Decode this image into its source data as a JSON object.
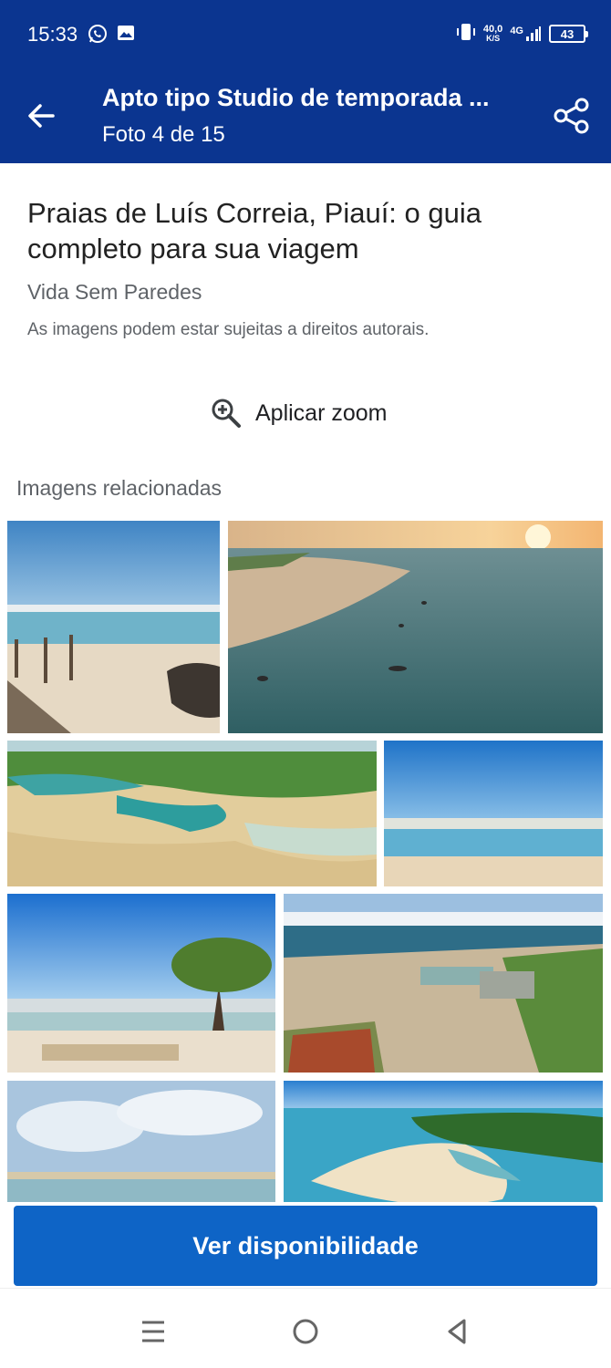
{
  "status_bar": {
    "time": "15:33",
    "icons_left": [
      "whatsapp-icon",
      "gallery-icon"
    ],
    "net_speed_value": "40,0",
    "net_speed_unit": "K/S",
    "network": "4G",
    "battery": "43"
  },
  "app_bar": {
    "title": "Apto tipo Studio de temporada ...",
    "subtitle": "Foto 4 de 15",
    "back_icon": "arrow-back-icon",
    "share_icon": "share-icon"
  },
  "photo": {
    "title": "Praias de Luís Correia, Piauí: o guia completo para sua viagem",
    "source": "Vida Sem Paredes",
    "copyright": "As imagens podem estar sujeitas a direitos autorais."
  },
  "zoom": {
    "label": "Aplicar zoom",
    "icon": "zoom-in-icon"
  },
  "related": {
    "heading": "Imagens relacionadas"
  },
  "cta": {
    "label": "Ver disponibilidade"
  },
  "nav": {
    "icons": [
      "menu-icon",
      "home-circle-icon",
      "back-triangle-icon"
    ]
  },
  "colors": {
    "header_bg": "#0b3590",
    "cta_bg": "#0e64c6"
  }
}
